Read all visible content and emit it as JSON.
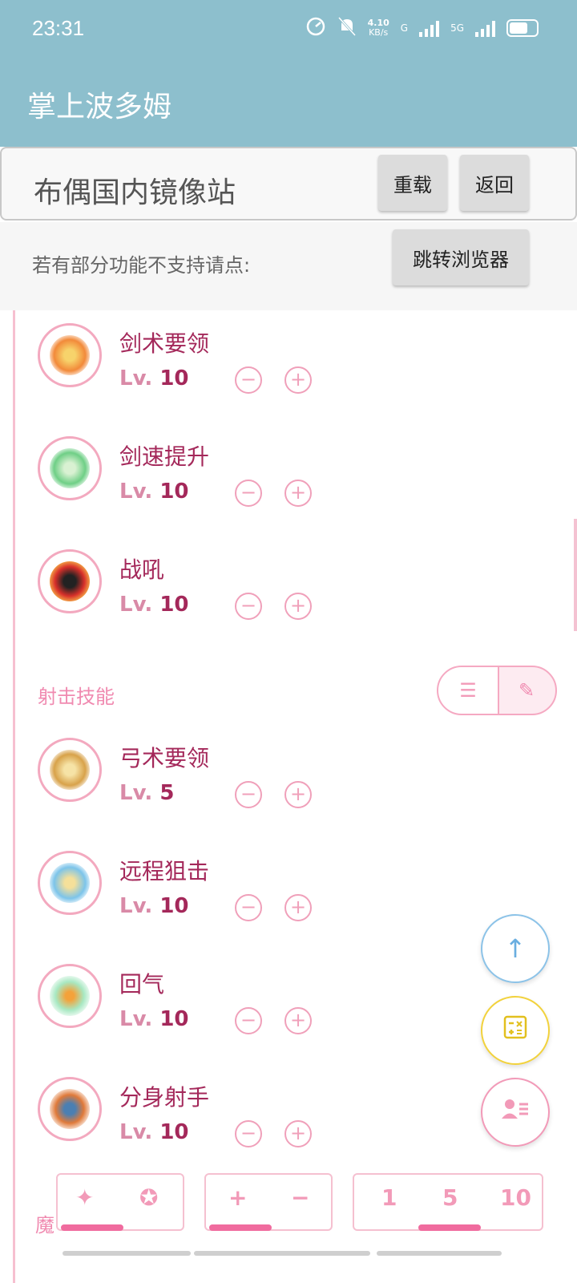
{
  "status": {
    "time": "23:31",
    "speed": "4.10",
    "speed_unit": "KB/s",
    "net1": "G",
    "net2": "5G"
  },
  "app": {
    "title": "掌上波多姆"
  },
  "source": {
    "name": "布偶国内镜像站",
    "reload_label": "重载",
    "back_label": "返回"
  },
  "notice": {
    "text": "若有部分功能不支持请点:",
    "browser_label": "跳转浏览器"
  },
  "lv_prefix": "Lv.",
  "skills_top": [
    {
      "name": "剑术要领",
      "level": "10",
      "icon": "sword-icon"
    },
    {
      "name": "剑速提升",
      "level": "10",
      "icon": "sword-speed-icon"
    },
    {
      "name": "战吼",
      "level": "10",
      "icon": "warcry-icon"
    }
  ],
  "section": {
    "title": "射击技能",
    "list_icon": "list-icon",
    "edit_icon": "pencil-icon"
  },
  "skills_shoot": [
    {
      "name": "弓术要领",
      "level": "5",
      "icon": "bow-icon"
    },
    {
      "name": "远程狙击",
      "level": "10",
      "icon": "snipe-icon"
    },
    {
      "name": "回气",
      "level": "10",
      "icon": "recover-icon"
    },
    {
      "name": "分身射手",
      "level": "10",
      "icon": "clone-archer-icon"
    }
  ],
  "toolbar": {
    "plus": "+",
    "minus": "−",
    "step1": "1",
    "step5": "5",
    "step10": "10",
    "magic_label": "魔"
  },
  "colors": {
    "header": "#8dbfcd",
    "accent": "#f06b9e",
    "text_skill": "#a4285a",
    "fab_top": "#8cc3e8",
    "fab_calc": "#f2d23c",
    "fab_profile": "#f29ab8"
  }
}
